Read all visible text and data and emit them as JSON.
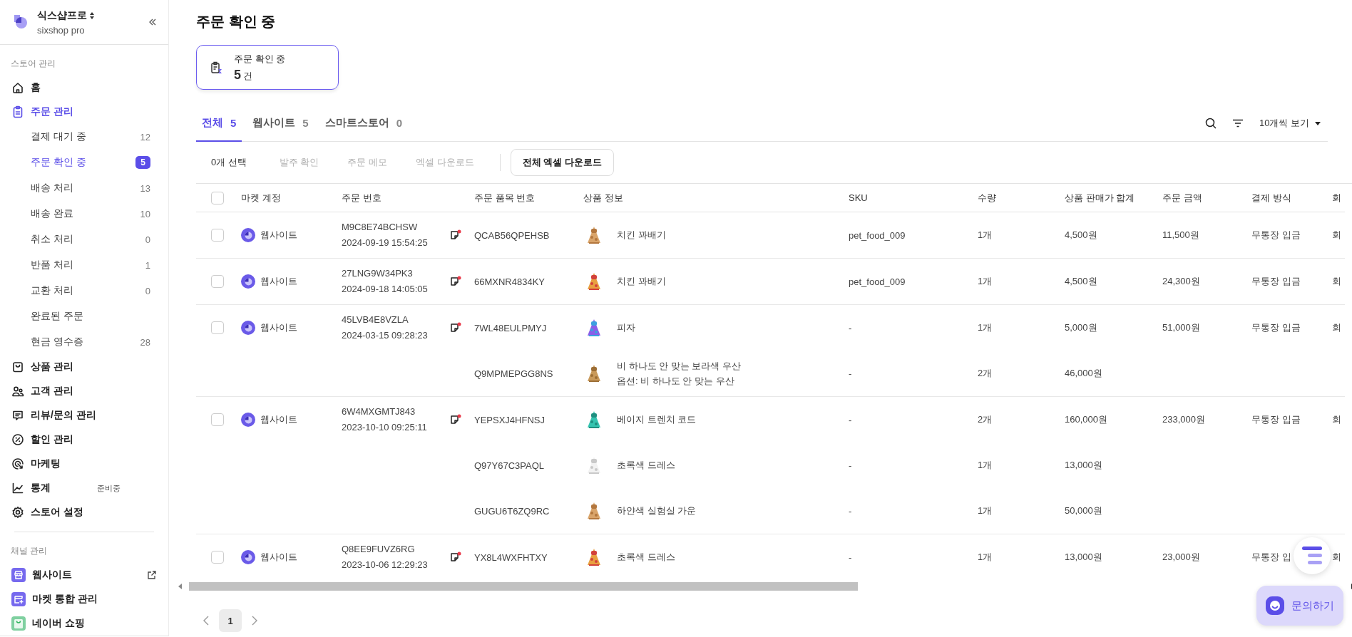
{
  "sidebar": {
    "store": {
      "name": "식스샵프로",
      "plan": "sixshop pro"
    },
    "sections": [
      {
        "title": "스토어 관리",
        "items": [
          {
            "label": "홈",
            "kind": "home",
            "selected": false
          },
          {
            "label": "주문 관리",
            "kind": "clipboard",
            "selected": true,
            "children": [
              {
                "label": "결제 대기 중",
                "count": "12",
                "selected": false
              },
              {
                "label": "주문 확인 중",
                "count": "5",
                "selected": true
              },
              {
                "label": "배송 처리",
                "count": "13",
                "selected": false
              },
              {
                "label": "배송 완료",
                "count": "10",
                "selected": false
              },
              {
                "label": "취소 처리",
                "count": "0",
                "selected": false
              },
              {
                "label": "반품 처리",
                "count": "1",
                "selected": false
              },
              {
                "label": "교환 처리",
                "count": "0",
                "selected": false
              },
              {
                "label": "완료된 주문",
                "selected": false
              },
              {
                "label": "현금 영수증",
                "count": "28",
                "selected": false
              }
            ]
          },
          {
            "label": "상품 관리",
            "kind": "bag",
            "selected": false
          },
          {
            "label": "고객 관리",
            "kind": "people",
            "selected": false
          },
          {
            "label": "리뷰/문의 관리",
            "kind": "chat",
            "selected": false
          },
          {
            "label": "할인 관리",
            "kind": "percent",
            "selected": false
          },
          {
            "label": "마케팅",
            "kind": "target",
            "selected": false
          },
          {
            "label": "통계",
            "kind": "chart",
            "selected": false,
            "badge": "준비중"
          },
          {
            "label": "스토어 설정",
            "kind": "gear",
            "selected": false
          }
        ]
      },
      {
        "title": "채널 관리",
        "items": [
          {
            "label": "웹사이트",
            "kind": "store",
            "selected": false,
            "external": true
          },
          {
            "label": "마켓 통합 관리",
            "kind": "storeplus",
            "selected": false
          },
          {
            "label": "네이버 쇼핑",
            "kind": "naver",
            "selected": false
          }
        ]
      }
    ]
  },
  "page_title": "주문 확인 중",
  "summary_card": {
    "label": "주문 확인 중",
    "count": "5",
    "unit": "건"
  },
  "tabs": [
    {
      "label": "전체",
      "count": "5",
      "selected": true
    },
    {
      "label": "웹사이트",
      "count": "5",
      "selected": false
    },
    {
      "label": "스마트스토어",
      "count": "0",
      "selected": false
    }
  ],
  "view_select": "10개씩 보기",
  "toolbar": {
    "selection": "0개 선택",
    "actions": [
      {
        "label": "발주 확인",
        "disabled": true
      },
      {
        "label": "주문 메모",
        "disabled": true
      },
      {
        "label": "엑셀 다운로드",
        "disabled": true
      },
      {
        "label": "전체 엑셀 다운로드",
        "disabled": false,
        "kind": "button"
      }
    ]
  },
  "table": {
    "header_checked": false,
    "columns": [
      "마켓 계정",
      "주문 번호",
      "주문 품목 번호",
      "상품 정보",
      "SKU",
      "수량",
      "상품 판매가 합계",
      "주문 금액",
      "결제 방식",
      "회"
    ],
    "rows": [
      {
        "checked": false,
        "market": "웹사이트",
        "order_no": "M9C8E74BCHSW",
        "ordered_at": "2024-09-19 15:54:25",
        "order_amount": "11,500원",
        "payment": "무통장 입금",
        "column_10": "회",
        "items": [
          {
            "item_no": "QCAB56QPEHSB",
            "product": "치킨 꽈배기",
            "sku": "pet_food_009",
            "qty": "1개",
            "total": "4,500원"
          }
        ]
      },
      {
        "checked": false,
        "market": "웹사이트",
        "order_no": "27LNG9W34PK3",
        "ordered_at": "2024-09-18 14:05:05",
        "order_amount": "24,300원",
        "payment": "무통장 입금",
        "column_10": "회",
        "items": [
          {
            "item_no": "66MXNR4834KY",
            "product": "치킨 꽈배기",
            "sku": "pet_food_009",
            "qty": "1개",
            "total": "4,500원"
          }
        ]
      },
      {
        "checked": false,
        "market": "웹사이트",
        "order_no": "45LVB4E8VZLA",
        "ordered_at": "2024-03-15 09:28:23",
        "order_amount": "51,000원",
        "payment": "무통장 입금",
        "column_10": "회",
        "items": [
          {
            "item_no": "7WL48EULPMYJ",
            "product": "피자",
            "sku": "-",
            "qty": "1개",
            "total": "5,000원"
          },
          {
            "item_no": "Q9MPMEPGG8NS",
            "product": "비 하나도 안 맞는 보라색 우산",
            "option": "옵션: 비 하나도 안 맞는 우산",
            "sku": "-",
            "qty": "2개",
            "total": "46,000원"
          }
        ]
      },
      {
        "checked": false,
        "market": "웹사이트",
        "order_no": "6W4MXGMTJ843",
        "ordered_at": "2023-10-10 09:25:11",
        "order_amount": "233,000원",
        "payment": "무통장 입금",
        "column_10": "회",
        "items": [
          {
            "item_no": "YEPSXJ4HFNSJ",
            "product": "베이지 트렌치 코드",
            "sku": "-",
            "qty": "2개",
            "total": "160,000원"
          },
          {
            "item_no": "Q97Y67C3PAQL",
            "product": "초록색 드레스",
            "sku": "-",
            "qty": "1개",
            "total": "13,000원"
          },
          {
            "item_no": "GUGU6T6ZQ9RC",
            "product": "하얀색 실험실 가운",
            "sku": "-",
            "qty": "1개",
            "total": "50,000원"
          }
        ]
      },
      {
        "checked": false,
        "market": "웹사이트",
        "order_no": "Q8EE9FUVZ6RG",
        "ordered_at": "2023-10-06 12:29:23",
        "order_amount": "23,000원",
        "payment": "무통장 입",
        "column_10": "회",
        "items": [
          {
            "item_no": "YX8L4WXFHTXY",
            "product": "초록색 드레스",
            "sku": "-",
            "qty": "1개",
            "total": "13,000원"
          }
        ]
      }
    ]
  },
  "pagination": {
    "pages": [
      {
        "label": "1",
        "selected": true
      }
    ]
  },
  "chat_button": "문의하기"
}
